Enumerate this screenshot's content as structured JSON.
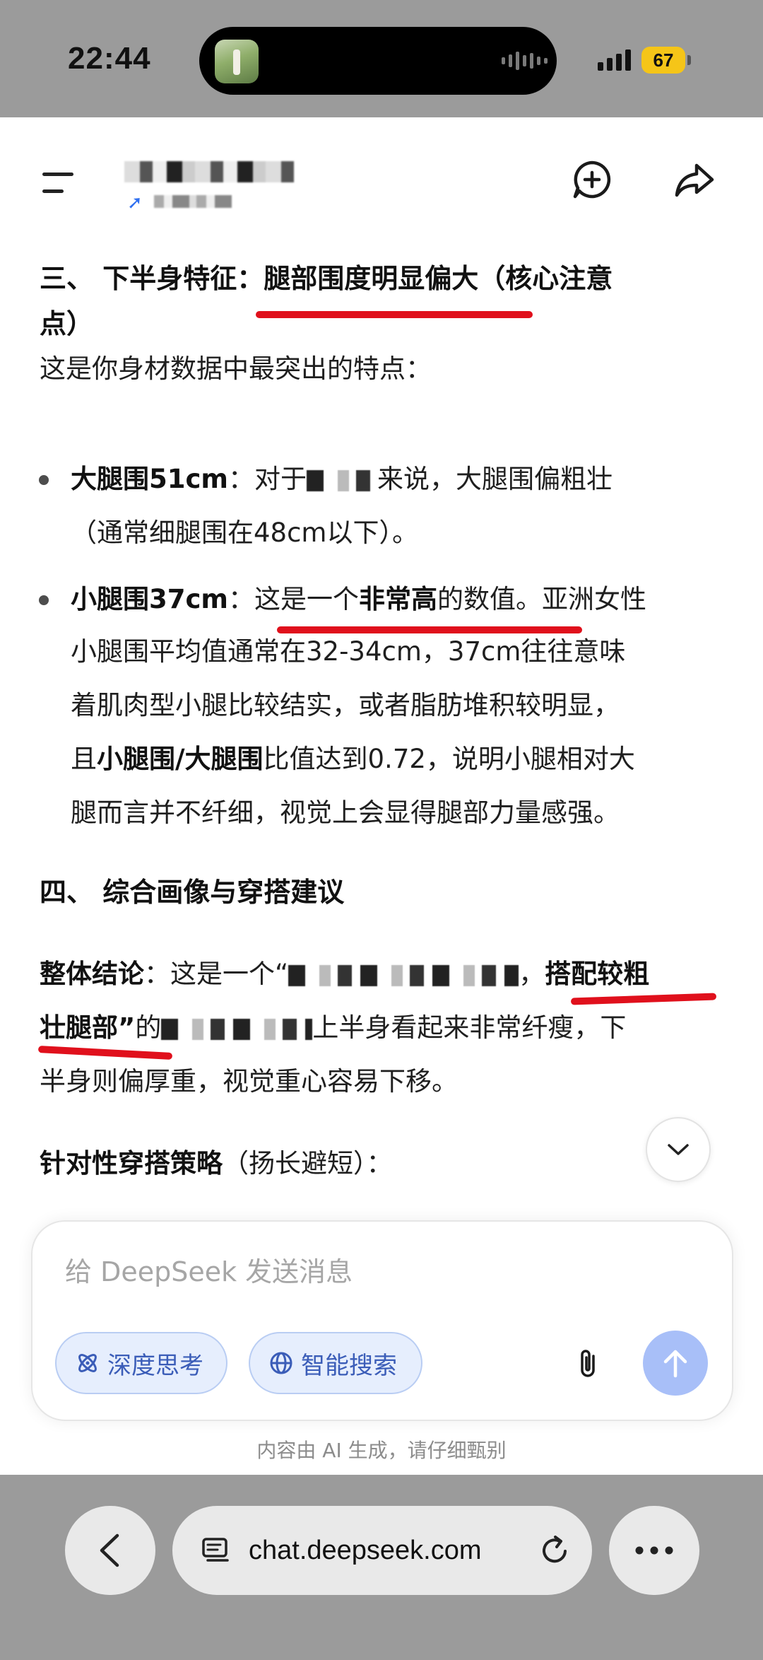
{
  "status_bar": {
    "time": "22:44",
    "battery": "67"
  },
  "header": {
    "menu_icon": "menu-icon",
    "new_chat_icon": "new-chat-icon",
    "share_icon": "share-icon"
  },
  "section3": {
    "heading_prefix": "三、 下半身特征：",
    "heading_emph": "腿部围度明显偏大",
    "heading_suffix": "（核心注意",
    "heading_line2": "点）",
    "intro": "这是你身材数据中最突出的特点："
  },
  "bullets": [
    {
      "label": "大腿围51cm",
      "line1_a": "：对于",
      "line1_b": "来说，大腿围偏粗壮",
      "line2": "（通常细腿围在48cm以下）。"
    },
    {
      "label": "小腿围37cm",
      "line1_a": "：",
      "line1_b": "这是一个",
      "line1_emph": "非常高",
      "line1_c": "的数值",
      "line1_d": "。亚洲女性",
      "line2": "小腿围平均值通常在32-34cm，37cm往往意味",
      "line3": "着肌肉型小腿比较结实，或者脂肪堆积较明显，",
      "line4_a": "且",
      "line4_emph": "小腿围/大腿围",
      "line4_b": "比值达到0.72，说明小腿相对大",
      "line5": "腿而言并不纤细，视觉上会显得腿部力量感强。"
    }
  ],
  "section4": {
    "heading": "四、 综合画像与穿搭建议",
    "conclusion_label": "整体结论",
    "conclusion_a": "：这是一个“",
    "conclusion_comma": "，",
    "conclusion_emph1": "搭配较粗",
    "conclusion_emph2": "壮腿部”",
    "conclusion_b": "的",
    "conclusion_c": "上半身看起来非常纤瘦，下",
    "conclusion_line3": "半身则偏厚重，视觉重心容易下移。",
    "strategy_label": "针对性穿搭策略",
    "strategy_suffix": "（扬长避短）："
  },
  "input": {
    "placeholder": "给 DeepSeek 发送消息",
    "deep_think": "深度思考",
    "web_search": "智能搜索"
  },
  "disclaimer": "内容由 AI 生成，请仔细甄别",
  "browser": {
    "url": "chat.deepseek.com"
  },
  "colors": {
    "accent": "#3b5db8",
    "send_button": "#a8bff8",
    "annotation_red": "#e0101c",
    "battery": "#f5c518"
  }
}
